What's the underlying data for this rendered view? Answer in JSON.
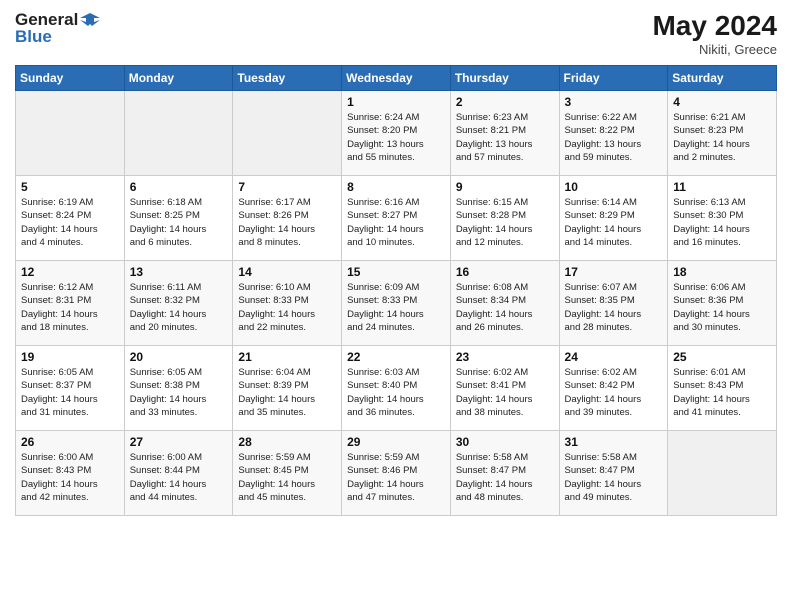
{
  "header": {
    "logo_line1": "General",
    "logo_line2": "Blue",
    "month": "May 2024",
    "location": "Nikiti, Greece"
  },
  "days_of_week": [
    "Sunday",
    "Monday",
    "Tuesday",
    "Wednesday",
    "Thursday",
    "Friday",
    "Saturday"
  ],
  "weeks": [
    [
      {
        "day": "",
        "info": ""
      },
      {
        "day": "",
        "info": ""
      },
      {
        "day": "",
        "info": ""
      },
      {
        "day": "1",
        "info": "Sunrise: 6:24 AM\nSunset: 8:20 PM\nDaylight: 13 hours\nand 55 minutes."
      },
      {
        "day": "2",
        "info": "Sunrise: 6:23 AM\nSunset: 8:21 PM\nDaylight: 13 hours\nand 57 minutes."
      },
      {
        "day": "3",
        "info": "Sunrise: 6:22 AM\nSunset: 8:22 PM\nDaylight: 13 hours\nand 59 minutes."
      },
      {
        "day": "4",
        "info": "Sunrise: 6:21 AM\nSunset: 8:23 PM\nDaylight: 14 hours\nand 2 minutes."
      }
    ],
    [
      {
        "day": "5",
        "info": "Sunrise: 6:19 AM\nSunset: 8:24 PM\nDaylight: 14 hours\nand 4 minutes."
      },
      {
        "day": "6",
        "info": "Sunrise: 6:18 AM\nSunset: 8:25 PM\nDaylight: 14 hours\nand 6 minutes."
      },
      {
        "day": "7",
        "info": "Sunrise: 6:17 AM\nSunset: 8:26 PM\nDaylight: 14 hours\nand 8 minutes."
      },
      {
        "day": "8",
        "info": "Sunrise: 6:16 AM\nSunset: 8:27 PM\nDaylight: 14 hours\nand 10 minutes."
      },
      {
        "day": "9",
        "info": "Sunrise: 6:15 AM\nSunset: 8:28 PM\nDaylight: 14 hours\nand 12 minutes."
      },
      {
        "day": "10",
        "info": "Sunrise: 6:14 AM\nSunset: 8:29 PM\nDaylight: 14 hours\nand 14 minutes."
      },
      {
        "day": "11",
        "info": "Sunrise: 6:13 AM\nSunset: 8:30 PM\nDaylight: 14 hours\nand 16 minutes."
      }
    ],
    [
      {
        "day": "12",
        "info": "Sunrise: 6:12 AM\nSunset: 8:31 PM\nDaylight: 14 hours\nand 18 minutes."
      },
      {
        "day": "13",
        "info": "Sunrise: 6:11 AM\nSunset: 8:32 PM\nDaylight: 14 hours\nand 20 minutes."
      },
      {
        "day": "14",
        "info": "Sunrise: 6:10 AM\nSunset: 8:33 PM\nDaylight: 14 hours\nand 22 minutes."
      },
      {
        "day": "15",
        "info": "Sunrise: 6:09 AM\nSunset: 8:33 PM\nDaylight: 14 hours\nand 24 minutes."
      },
      {
        "day": "16",
        "info": "Sunrise: 6:08 AM\nSunset: 8:34 PM\nDaylight: 14 hours\nand 26 minutes."
      },
      {
        "day": "17",
        "info": "Sunrise: 6:07 AM\nSunset: 8:35 PM\nDaylight: 14 hours\nand 28 minutes."
      },
      {
        "day": "18",
        "info": "Sunrise: 6:06 AM\nSunset: 8:36 PM\nDaylight: 14 hours\nand 30 minutes."
      }
    ],
    [
      {
        "day": "19",
        "info": "Sunrise: 6:05 AM\nSunset: 8:37 PM\nDaylight: 14 hours\nand 31 minutes."
      },
      {
        "day": "20",
        "info": "Sunrise: 6:05 AM\nSunset: 8:38 PM\nDaylight: 14 hours\nand 33 minutes."
      },
      {
        "day": "21",
        "info": "Sunrise: 6:04 AM\nSunset: 8:39 PM\nDaylight: 14 hours\nand 35 minutes."
      },
      {
        "day": "22",
        "info": "Sunrise: 6:03 AM\nSunset: 8:40 PM\nDaylight: 14 hours\nand 36 minutes."
      },
      {
        "day": "23",
        "info": "Sunrise: 6:02 AM\nSunset: 8:41 PM\nDaylight: 14 hours\nand 38 minutes."
      },
      {
        "day": "24",
        "info": "Sunrise: 6:02 AM\nSunset: 8:42 PM\nDaylight: 14 hours\nand 39 minutes."
      },
      {
        "day": "25",
        "info": "Sunrise: 6:01 AM\nSunset: 8:43 PM\nDaylight: 14 hours\nand 41 minutes."
      }
    ],
    [
      {
        "day": "26",
        "info": "Sunrise: 6:00 AM\nSunset: 8:43 PM\nDaylight: 14 hours\nand 42 minutes."
      },
      {
        "day": "27",
        "info": "Sunrise: 6:00 AM\nSunset: 8:44 PM\nDaylight: 14 hours\nand 44 minutes."
      },
      {
        "day": "28",
        "info": "Sunrise: 5:59 AM\nSunset: 8:45 PM\nDaylight: 14 hours\nand 45 minutes."
      },
      {
        "day": "29",
        "info": "Sunrise: 5:59 AM\nSunset: 8:46 PM\nDaylight: 14 hours\nand 47 minutes."
      },
      {
        "day": "30",
        "info": "Sunrise: 5:58 AM\nSunset: 8:47 PM\nDaylight: 14 hours\nand 48 minutes."
      },
      {
        "day": "31",
        "info": "Sunrise: 5:58 AM\nSunset: 8:47 PM\nDaylight: 14 hours\nand 49 minutes."
      },
      {
        "day": "",
        "info": ""
      }
    ]
  ]
}
